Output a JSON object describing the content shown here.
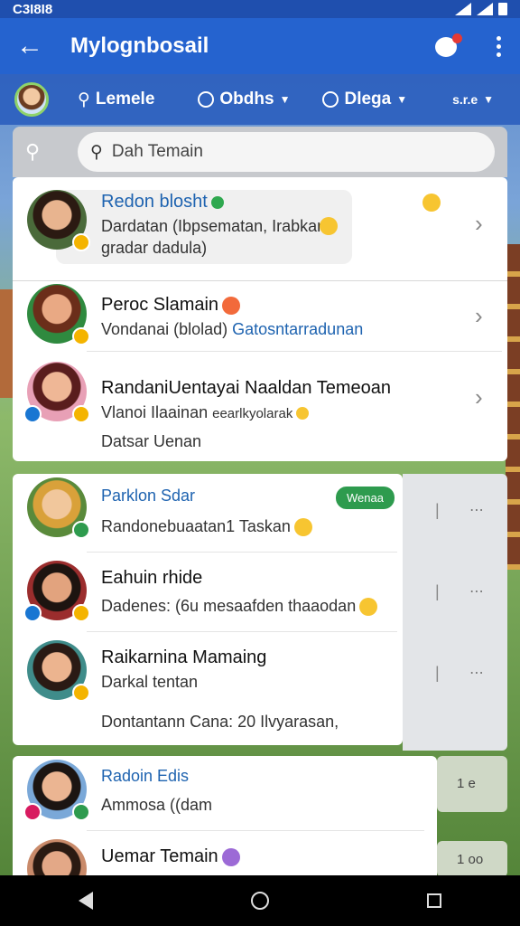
{
  "status_bar": {
    "left_text": "C3I8I8"
  },
  "app_bar": {
    "title": "Mylognbosail"
  },
  "filters": {
    "f1": "Lemele",
    "f2": "Obdhs",
    "f3": "Dlega",
    "f4": "s.r.e"
  },
  "search": {
    "placeholder": "Dah Temain"
  },
  "card1": {
    "rows": [
      {
        "name": "Redon blosht",
        "line1": "Dardatan (Ibpsematan, Irabkan",
        "line2": "gradar dadula)"
      },
      {
        "name": "Peroc Slamain",
        "line1": "Vondanai (blolad)",
        "line1b": "Gatosntarradunan"
      },
      {
        "name": "RandaniUentayai Naaldan Temeoan",
        "line1": "Vlanoi Ilaainan",
        "line1b": "eearlkyolarak",
        "line2": "Datsar Uenan"
      }
    ]
  },
  "card2": {
    "rows": [
      {
        "name": "Parklon Sdar",
        "tag": "Wenaa",
        "line1": "Randonebuaatan1 Taskan"
      },
      {
        "name": "Eahuin rhide",
        "line1": "Dadenes: (6u mesaafden thaaodan"
      },
      {
        "name": "Raikarnina Mamaing",
        "line1": "Darkal tentan",
        "line2": "Dontantann Cana: 20 Ilvyarasan,"
      }
    ]
  },
  "card3": {
    "rows": [
      {
        "name": "Radoin Edis",
        "line1": "Ammosa ((dam"
      },
      {
        "name": "Uemar Temain"
      }
    ]
  },
  "side": {
    "s1": "1 e",
    "s2": "1 oo"
  },
  "colors": {
    "app_bar": "#2563cf",
    "status_bar": "#1f4fae",
    "tag_green": "#2e9b4e",
    "name_blue": "#1e63b0"
  }
}
